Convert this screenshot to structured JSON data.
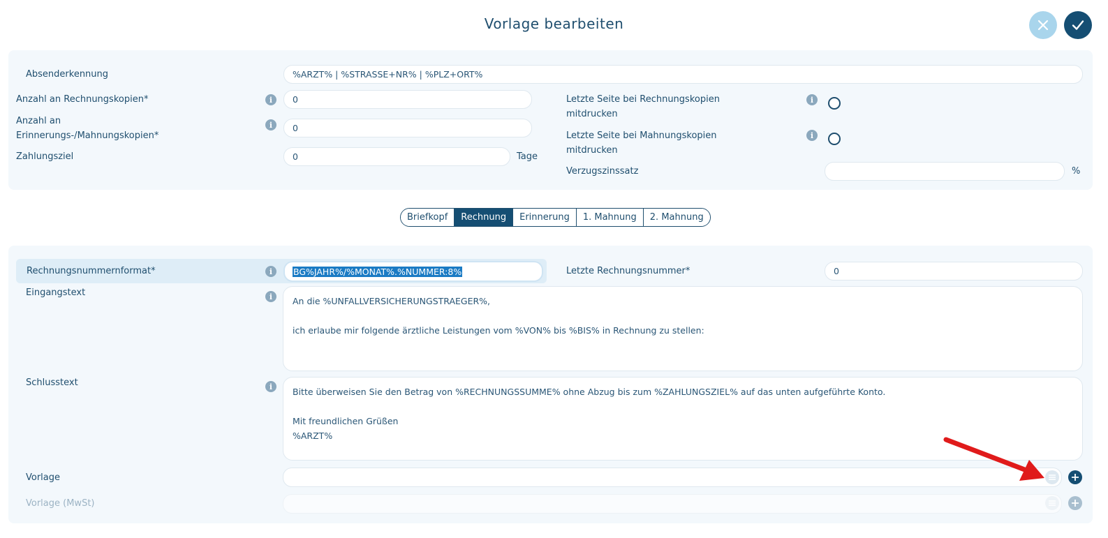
{
  "header": {
    "title": "Vorlage bearbeiten",
    "cancel_icon": "close-icon",
    "confirm_icon": "check-icon"
  },
  "general": {
    "absender_label": "Absenderkennung",
    "absender_value": "%ARZT% | %STRASSE+NR% | %PLZ+ORT%",
    "rechnungskopien_label": "Anzahl an Rechnungskopien*",
    "rechnungskopien_value": "0",
    "mahnungskopien_label_line1": "Anzahl an",
    "mahnungskopien_label_line2": "Erinnerungs-/Mahnungskopien*",
    "mahnungskopien_value": "0",
    "zahlungsziel_label": "Zahlungsziel",
    "zahlungsziel_value": "0",
    "zahlungsziel_unit": "Tage",
    "letzte_seite_rechnung_line1": "Letzte Seite bei Rechnungskopien",
    "letzte_seite_rechnung_line2": "mitdrucken",
    "letzte_seite_mahnung_line1": "Letzte Seite bei Mahnungskopien",
    "letzte_seite_mahnung_line2": "mitdrucken",
    "verzugszinssatz_label": "Verzugszinssatz",
    "verzugszinssatz_value": "",
    "verzugszinssatz_unit": "%"
  },
  "tabs": [
    {
      "label": "Briefkopf",
      "active": false
    },
    {
      "label": "Rechnung",
      "active": true
    },
    {
      "label": "Erinnerung",
      "active": false
    },
    {
      "label": "1. Mahnung",
      "active": false
    },
    {
      "label": "2. Mahnung",
      "active": false
    }
  ],
  "invoice": {
    "nummernformat_label": "Rechnungsnummernformat*",
    "nummernformat_value": "BG%JAHR%/%MONAT%.%NUMMER:8%",
    "letzte_nummer_label": "Letzte Rechnungsnummer*",
    "letzte_nummer_value": "0",
    "eingangstext_label": "Eingangstext",
    "eingangstext_value": "An die %UNFALLVERSICHERUNGSTRAEGER%,\n\nich erlaube mir folgende ärztliche Leistungen vom %VON% bis %BIS% in Rechnung zu stellen:",
    "schlusstext_label": "Schlusstext",
    "schlusstext_value": "Bitte überweisen Sie den Betrag von %RECHNUNGSSUMME% ohne Abzug bis zum %ZAHLUNGSZIEL% auf das unten aufgeführte Konto.\n\nMit freundlichen Grüßen\n%ARZT%",
    "vorlage_label": "Vorlage",
    "vorlage_value": "",
    "vorlage_mwst_label": "Vorlage (MwSt)",
    "vorlage_mwst_value": ""
  },
  "icons": {
    "info": "info-icon",
    "list": "list-icon",
    "add": "plus-icon",
    "arrow": "red-arrow-annotation"
  },
  "colors": {
    "primary": "#154e73",
    "cancel": "#a9d5ec",
    "panel_bg": "#f3f8fc",
    "annotation_arrow": "#e01b1b"
  }
}
